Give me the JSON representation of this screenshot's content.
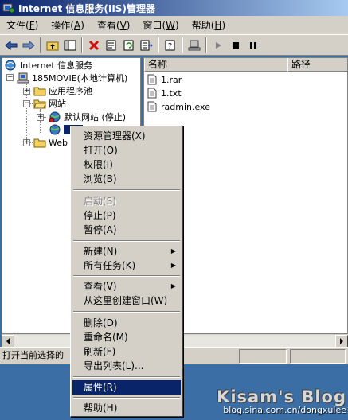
{
  "window": {
    "title": "Internet 信息服务(IIS)管理器"
  },
  "menubar": [
    {
      "label": "文件(",
      "key": "F",
      "tail": ")"
    },
    {
      "label": "操作(",
      "key": "A",
      "tail": ")"
    },
    {
      "label": "查看(",
      "key": "V",
      "tail": ")"
    },
    {
      "label": "窗口(",
      "key": "W",
      "tail": ")"
    },
    {
      "label": "帮助(",
      "key": "H",
      "tail": ")"
    }
  ],
  "tree": {
    "root": "Internet 信息服务",
    "computer": "185MOVIE(本地计算机)",
    "app_pools": "应用程序池",
    "websites": "网站",
    "default_site": "默认网站 (停止)",
    "web_ext": "Web"
  },
  "list": {
    "headers": [
      "名称",
      "路径"
    ],
    "files": [
      "1.rar",
      "1.txt",
      "radmin.exe"
    ]
  },
  "status": {
    "text": "打开当前选择的"
  },
  "context_menu": {
    "items": [
      {
        "label": "资源管理器(X)",
        "disabled": false
      },
      {
        "label": "打开(O)",
        "disabled": false
      },
      {
        "label": "权限(I)",
        "disabled": false
      },
      {
        "label": "浏览(B)",
        "disabled": false
      },
      {
        "label": "启动(S)",
        "disabled": true
      },
      {
        "label": "停止(P)",
        "disabled": false
      },
      {
        "label": "暂停(A)",
        "disabled": false
      },
      {
        "label": "新建(N)",
        "disabled": false,
        "submenu": true
      },
      {
        "label": "所有任务(K)",
        "disabled": false,
        "submenu": true
      },
      {
        "label": "查看(V)",
        "disabled": false,
        "submenu": true
      },
      {
        "label": "从这里创建窗口(W)",
        "disabled": false
      },
      {
        "label": "删除(D)",
        "disabled": false
      },
      {
        "label": "重命名(M)",
        "disabled": false
      },
      {
        "label": "刷新(F)",
        "disabled": false
      },
      {
        "label": "导出列表(L)...",
        "disabled": false
      },
      {
        "label": "属性(R)",
        "disabled": false,
        "selected": true
      },
      {
        "label": "帮助(H)",
        "disabled": false
      }
    ]
  },
  "watermark": {
    "title": "Kisam's Blog",
    "url": "blog.sina.com.cn/dongxulee"
  },
  "colors": {
    "title_start": "#0a246a",
    "title_end": "#a6caf0",
    "face": "#d4d0c8",
    "desktop": "#3a6ea5",
    "highlight": "#0a246a"
  }
}
